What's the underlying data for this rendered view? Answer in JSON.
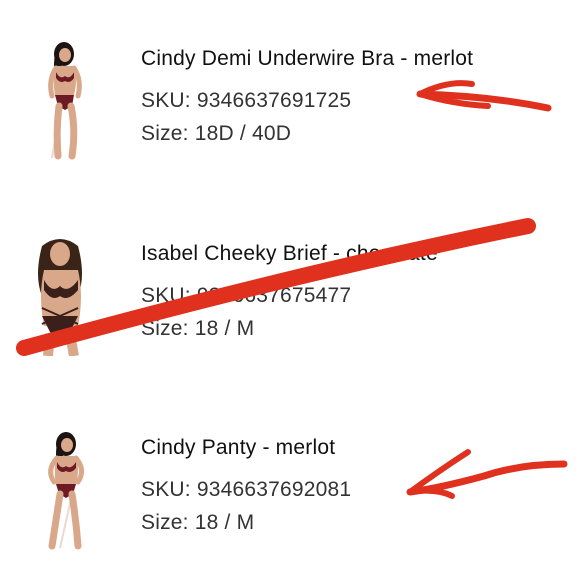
{
  "items": [
    {
      "name": "Cindy Demi Underwire Bra - merlot",
      "sku": "SKU: 9346637691725",
      "size": "Size: 18D / 40D",
      "thumbnail_icon": "model-photo-bra-icon",
      "annotation": "arrow-pointing"
    },
    {
      "name": "Isabel Cheeky Brief - chocolate",
      "sku": "SKU: 9346637675477",
      "size": "Size: 18 / M",
      "thumbnail_icon": "model-photo-brief-icon",
      "annotation": "crossed-out"
    },
    {
      "name": "Cindy Panty - merlot",
      "sku": "SKU: 9346637692081",
      "size": "Size: 18 / M",
      "thumbnail_icon": "model-photo-panty-icon",
      "annotation": "arrow-pointing"
    }
  ],
  "colors": {
    "annotation_red": "#e0301e",
    "merlot": "#6e1a24",
    "chocolate": "#3b1f1a",
    "skin": "#d9a88a",
    "hair": "#1c1412"
  }
}
